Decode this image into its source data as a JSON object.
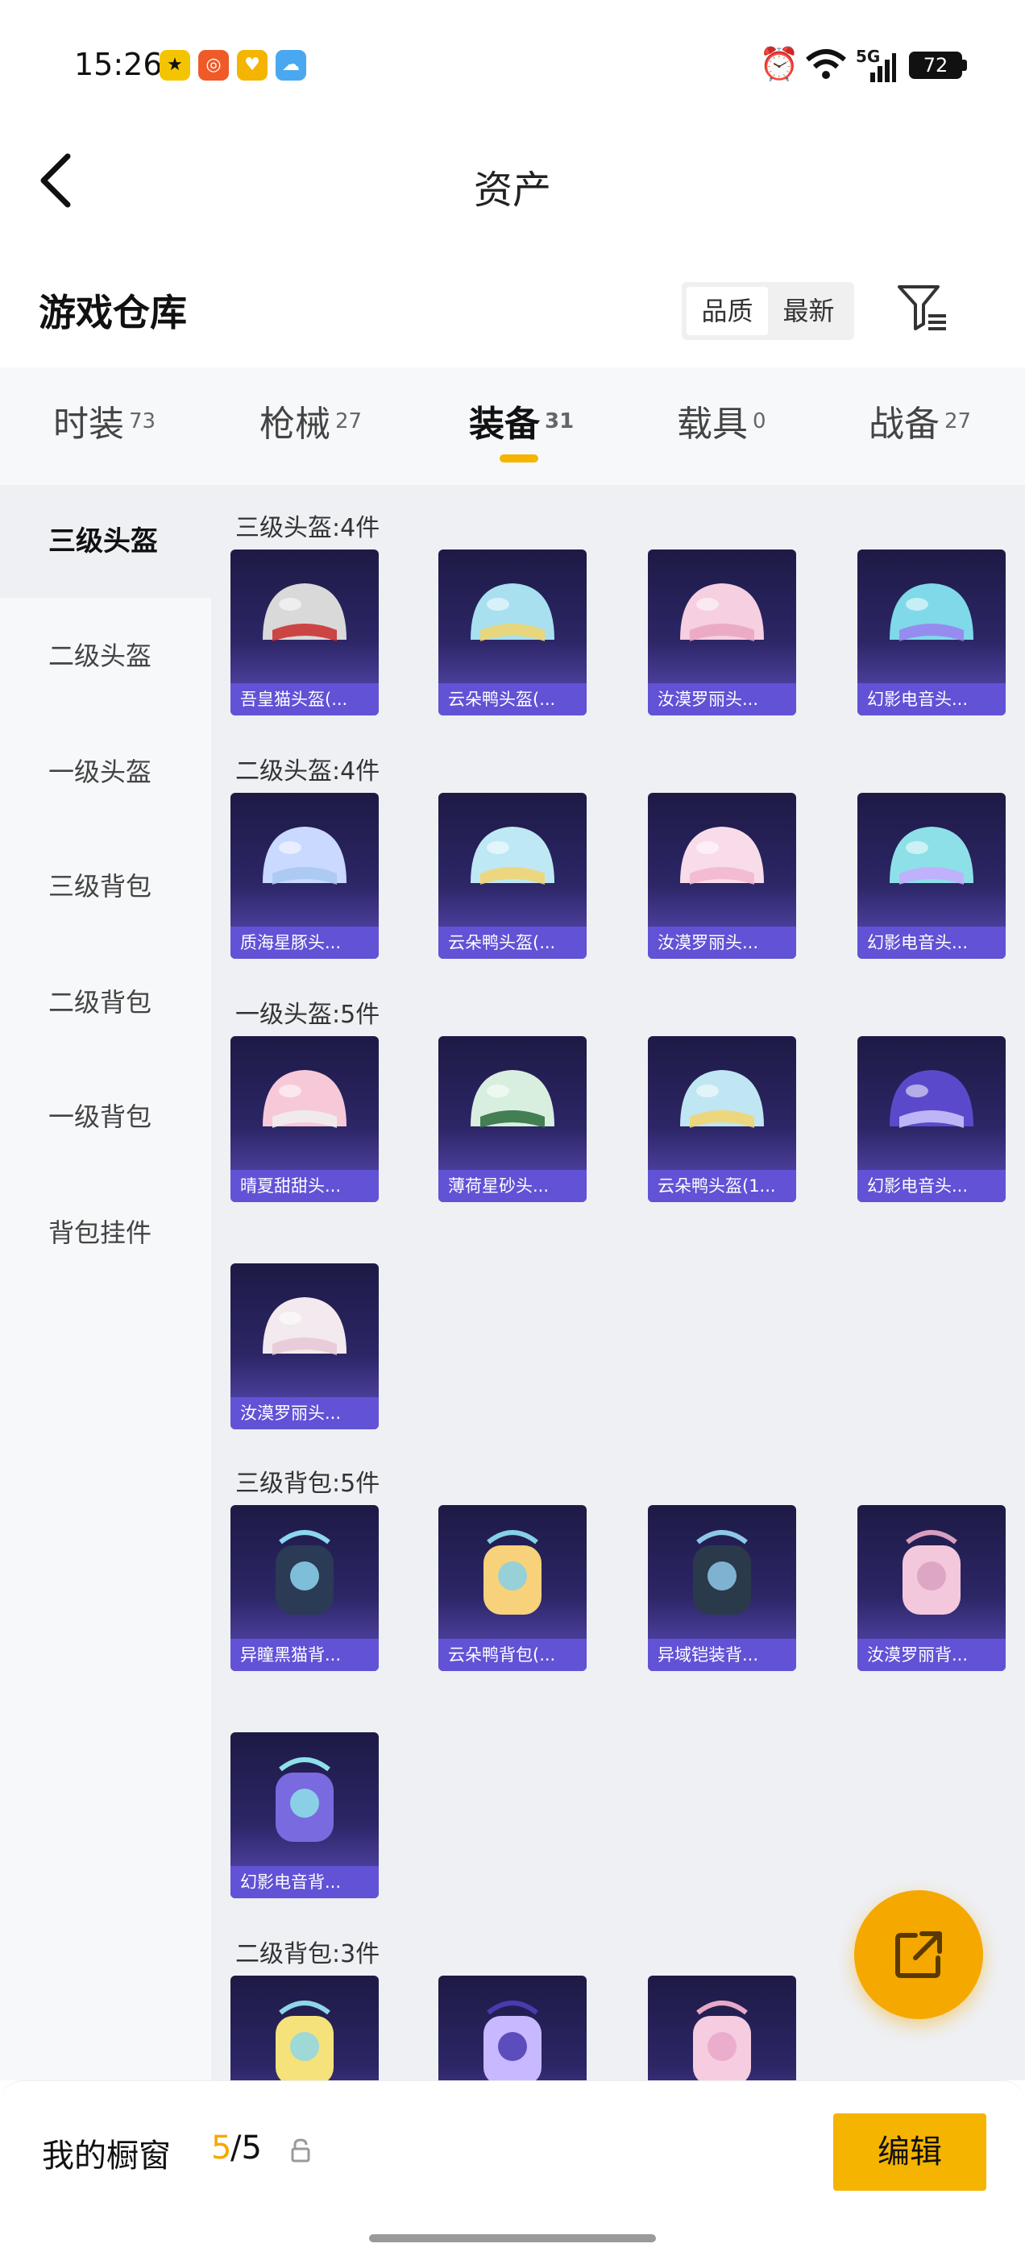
{
  "status_bar": {
    "time": "15:26",
    "network": "5G",
    "battery": "72"
  },
  "header": {
    "title": "资产"
  },
  "warehouse": {
    "title": "游戏仓库",
    "sort_options": [
      "品质",
      "最新"
    ],
    "sort_active": "品质"
  },
  "tabs": [
    {
      "label": "时装",
      "count": "73"
    },
    {
      "label": "枪械",
      "count": "27"
    },
    {
      "label": "装备",
      "count": "31",
      "active": true
    },
    {
      "label": "载具",
      "count": "0"
    },
    {
      "label": "战备",
      "count": "27"
    }
  ],
  "sidebar": [
    {
      "label": "三级头盔",
      "active": true
    },
    {
      "label": "二级头盔"
    },
    {
      "label": "一级头盔"
    },
    {
      "label": "三级背包"
    },
    {
      "label": "二级背包"
    },
    {
      "label": "一级背包"
    },
    {
      "label": "背包挂件"
    }
  ],
  "groups": [
    {
      "label": "三级头盔:4件",
      "items": [
        "吾皇猫头盔(...",
        "云朵鸭头盔(...",
        "汝漠罗丽头...",
        "幻影电音头..."
      ]
    },
    {
      "label": "二级头盔:4件",
      "items": [
        "质海星豚头...",
        "云朵鸭头盔(...",
        "汝漠罗丽头...",
        "幻影电音头..."
      ]
    },
    {
      "label": "一级头盔:5件",
      "items": [
        "晴夏甜甜头...",
        "薄荷星砂头...",
        "云朵鸭头盔(1...",
        "幻影电音头...",
        "汝漠罗丽头..."
      ]
    },
    {
      "label": "三级背包:5件",
      "items": [
        "异瞳黑猫背...",
        "云朵鸭背包(...",
        "异域铠装背...",
        "汝漠罗丽背...",
        "幻影电音背..."
      ]
    },
    {
      "label": "二级背包:3件",
      "items": [
        "",
        "",
        ""
      ]
    }
  ],
  "bottom": {
    "window_label": "我的橱窗",
    "used": "5",
    "total": "/5",
    "edit_label": "编辑"
  },
  "colors": {
    "accent": "#f5b400",
    "card_bg": "#2c2666",
    "card_label": "#6152d6"
  }
}
